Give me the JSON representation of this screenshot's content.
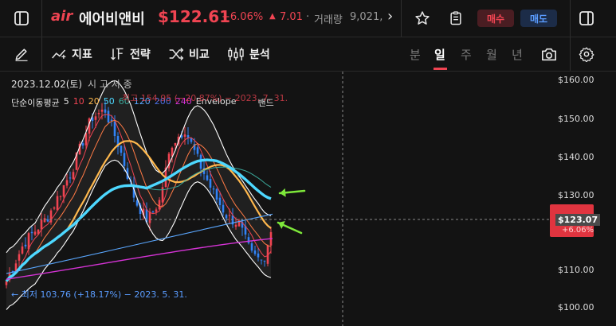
{
  "header": {
    "logo_text": "air",
    "stock_name": "에어비앤비",
    "price": "$122.61",
    "change_pct": "+6.06%",
    "change_abs": "7.01",
    "volume_label": "거래량",
    "volume_value": "9,021,",
    "more_glyph": "›",
    "buy_label": "매수",
    "sell_label": "매도"
  },
  "toolbar": {
    "indicator_label": "지표",
    "strategy_label": "전략",
    "compare_label": "비교",
    "analysis_label": "분석",
    "periods": [
      "분",
      "일",
      "주",
      "월",
      "년"
    ],
    "active_period": "일"
  },
  "chart": {
    "info_date": "2023.12.02(토)",
    "info_ohlc": "시   고   저   종",
    "legend_name": "단순이동평균",
    "legend_periods": [
      "5",
      "10",
      "20",
      "50",
      "60",
      "120",
      "200",
      "240"
    ],
    "legend_envelope": "Envelope",
    "legend_band": "밴드",
    "high_marker": "최고 154.95 (−20.87%) − 2023. 7. 31.",
    "low_marker": "← 최저 103.76 (+18.17%) − 2023. 5. 31.",
    "current_price_label": "$123.07",
    "current_pct_label": "+6.06%",
    "price_axis": [
      "$160.00",
      "$150.00",
      "$140.00",
      "$130.00",
      "$110.00",
      "$100.00"
    ]
  },
  "colors": {
    "up": "#f04452",
    "down": "#3182f6",
    "ma5": "#f04452",
    "ma10": "#ff7a45",
    "ma20": "#ffb84d",
    "ma50": "#4dd8ff",
    "ma60": "#3aa89a",
    "ma120": "#5aa7ff",
    "ma200": "#b040e0",
    "ma240": "#d633d6",
    "envelope": "#ffffff",
    "arrow": "#7ee83a",
    "badge_red": "#e0343f"
  },
  "icons": [
    "sidebar-toggle-icon",
    "star-icon",
    "clipboard-icon",
    "panel-icon",
    "pencil-icon",
    "indicator-icon",
    "strategy-icon",
    "compare-icon",
    "analysis-icon",
    "camera-icon",
    "gear-icon"
  ]
}
